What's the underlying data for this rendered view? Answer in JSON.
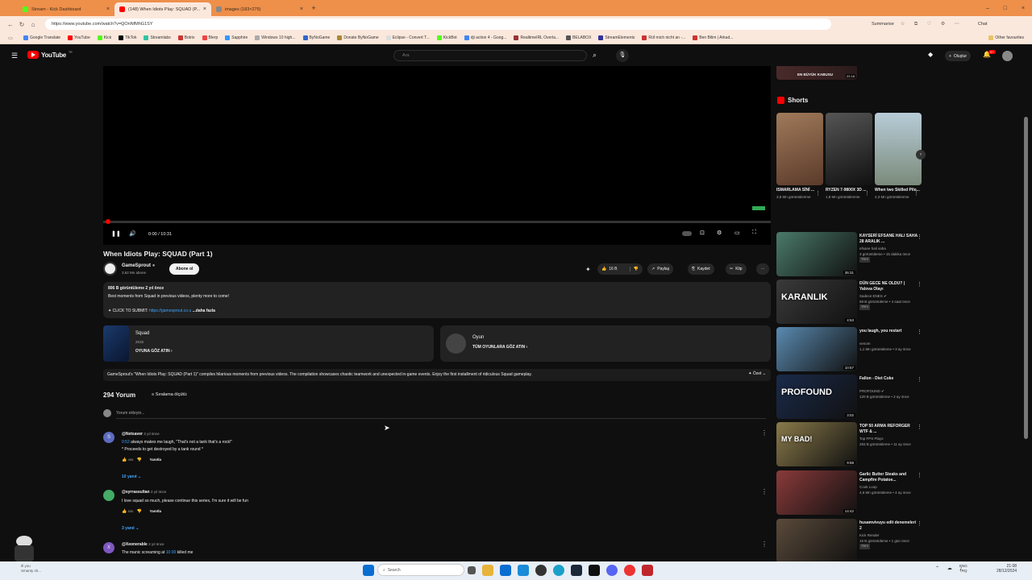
{
  "browser": {
    "tabs": [
      {
        "title": "Stream - Kick Dashboard",
        "color": "#53fc18",
        "active": false
      },
      {
        "title": "(148) When Idiots Play: SQUAD (P...",
        "color": "#ff0000",
        "active": true
      },
      {
        "title": "images (183×275)",
        "color": "#888888",
        "active": false
      }
    ],
    "url": "https://www.youtube.com/watch?v=QOnNfMhG1SY",
    "summarise": "Summarise",
    "chat": "Chat",
    "bookmarks": [
      "Google Translate",
      "YouTube",
      "Kick",
      "TikTok",
      "Streamlabs",
      "Botrix",
      "Blerp",
      "Sapphire",
      "Windows 10 high...",
      "ByNoGame",
      "Donate ByNoGame",
      "Eclipse - Convert T...",
      "KickBot",
      "dji action 4 - Goog...",
      "RealtimeIRL Overla...",
      "BELABOX",
      "StreamElements",
      "Rüf mich nicht an -...",
      "Ben Bilim | Arkad...",
      "Other favourites"
    ]
  },
  "yt": {
    "logo": "YouTube",
    "logo_sup": "TR",
    "search_placeholder": "Ara",
    "create": "Oluştur",
    "notif_count": "9+"
  },
  "player": {
    "time": "0:00 / 10:31",
    "progress": 0.0
  },
  "video": {
    "title": "When Idiots Play: SQUAD (Part 1)",
    "channel": "GameSprout",
    "subs": "3,62 Mn abone",
    "subscribe": "Abone ol",
    "likes": "16 B",
    "share": "Paylaş",
    "save": "Kaydet",
    "clip": "Klip"
  },
  "description": {
    "meta": "806 B görüntüleme  2 yıl önce",
    "line1": "Best moments from Squad in previous videos, plenty more to come!",
    "line2_prefix": "✦ CLICK TO SUBMIT: ",
    "line2_link": "https://gamesprout.co.u",
    "more": "...daha fazla"
  },
  "cards": [
    {
      "title": "Squad",
      "sub": "2015",
      "link": "OYUNA GÖZ ATIN"
    },
    {
      "title": "Oyun",
      "sub": "",
      "link": "TÜM OYUNLARA GÖZ ATIN"
    }
  ],
  "summary": {
    "text": "GameSprout's \"When Idiots Play: SQUAD (Part 1)\" compiles hilarious moments from previous videos. The compilation showcases chaotic teamwork and unexpected in-game events. Enjoy the first installment of ridiculous Squad gameplay.",
    "label": "Özet"
  },
  "comments_header": {
    "count": "294 Yorum",
    "sort": "Sıralama ölçütü:",
    "add": "Yorum ekleyin..."
  },
  "comments": [
    {
      "user": "@Netsaver",
      "time": "2 yıl önce",
      "ts": "0:52",
      "text": " always makes me laugh, \"That's not a tank that's a rock!\"",
      "text2": "* Proceeds to get destroyed by a tank round *",
      "likes": "495",
      "reply": "Yanıtla",
      "replies": "10 yanıt",
      "initial": "S",
      "color": "#5c6bc0"
    },
    {
      "user": "@syrrassultan",
      "time": "2 yıl önce",
      "text": "I love squad so much, please continue this series, I'm sure it will be fun",
      "likes": "530",
      "reply": "Yanıtla",
      "replies": "3 yanıt",
      "initial": "",
      "color": "#4a6"
    },
    {
      "user": "@Xeonerable",
      "time": "2 yıl önce",
      "text_prefix": "The manic screaming at ",
      "ts": "10:00",
      "text_suffix": " killed me",
      "initial": "X",
      "color": "#7e57c2"
    }
  ],
  "shorts_title": "Shorts",
  "top_thumb_label": "EN BÜYÜK KABUSU",
  "top_thumb_dur": "22:18",
  "shorts": [
    {
      "title": "ISMARLAMA SİNİ ...",
      "views": "3,8 Mn görüntülenme",
      "color": "#7a5a3a"
    },
    {
      "title": "RYZEN 7-9800X 3D ...",
      "views": "1,8 Mn görüntülenme",
      "color": "#2a2a2a"
    },
    {
      "title": "When two Skilled Pilo...",
      "views": "2,3 Mn görüntülenme",
      "color": "#8fa8b8"
    }
  ],
  "recs": [
    {
      "title": "KAYSERİ EFSANE HALI SAHA 28 ARALIK ...",
      "ch": "efsane hali saha",
      "meta": "3 görüntüleme • 15 dakika önce",
      "badge": "Yeni",
      "dur": "35:31",
      "color": "#4a7a6a"
    },
    {
      "title": "DÜN GECE NE OLDU? | Yalova Olayı",
      "ch": "Sadece ENES ✔",
      "meta": "58 B görüntüleme • 4 saat önce",
      "badge": "Yeni",
      "dur": "4:53",
      "color": "#3a3a3a",
      "overlay": "KARANLIK"
    },
    {
      "title": "you laugh, you restart",
      "ch": "venom",
      "meta": "1,1 Mn görüntüleme • 3 ay önce",
      "badge": "",
      "dur": "10:57",
      "color": "#5a8ab0"
    },
    {
      "title": "Fallon - Diet Coke",
      "ch": "PROFOUND ✔",
      "meta": "120 B görüntüleme • 2 ay önce",
      "badge": "",
      "dur": "3:02",
      "color": "#1a2a4a",
      "overlay": "PROFOUND"
    },
    {
      "title": "TOP 50 ARMA REFORGER WTF & ...",
      "ch": "Top FPS Plays",
      "meta": "283 B görüntüleme • 11 ay önce",
      "badge": "",
      "dur": "9:58",
      "color": "#8a7a4a",
      "overlay": "MY BAD!"
    },
    {
      "title": "Garlic Butter Steaks and Campfire Potatoe...",
      "ch": "Cook Loop",
      "meta": "4,6 Mn görüntüleme • 4 ay önce",
      "badge": "",
      "dur": "14:42",
      "color": "#8a3a3a"
    },
    {
      "title": "husamvivuyu edit denemeleri 2",
      "ch": "Kick Render",
      "meta": "16 B görüntüleme • 1 gün önce",
      "badge": "Yeni",
      "dur": "",
      "color": "#5a4a3a"
    }
  ],
  "taskbar": {
    "search": "Search",
    "weather_line1": "Ill you",
    "weather_line2": "Smanty sh...",
    "lang": "ENG",
    "lang2": "TRQ",
    "time": "21:08",
    "date": "28/12/2024"
  }
}
